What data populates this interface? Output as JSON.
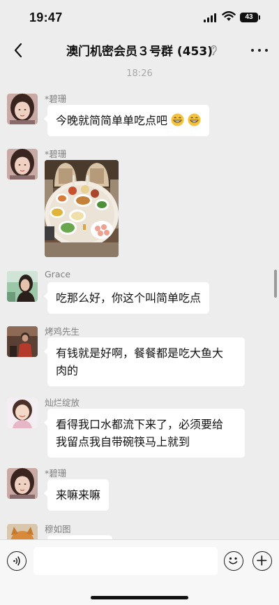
{
  "status_bar": {
    "time": "19:47",
    "battery_level": "43",
    "icons": [
      "signal-icon",
      "wifi-icon",
      "battery-icon"
    ]
  },
  "nav": {
    "title": "澳门机密会员３号群 (453)",
    "back_icon": "chevron-left-icon",
    "mute_icon": "ear-icon",
    "more_icon": "more-dots-icon"
  },
  "chat": {
    "timestamp": "18:26",
    "messages": [
      {
        "sender": "*碧珊",
        "type": "text",
        "text": "今晚就简简单单吃点吧",
        "emoji": "grinning-face-icon ×2"
      },
      {
        "sender": "*碧珊",
        "type": "image",
        "image": "dinner-table-photo"
      },
      {
        "sender": "Grace",
        "type": "text",
        "text": "吃那么好，你这个叫简单吃点"
      },
      {
        "sender": "烤鸡先生",
        "type": "text",
        "text_lines": [
          "有钱就是好啊，餐餐都是吃大鱼大",
          "肉的"
        ]
      },
      {
        "sender": "灿烂绽放",
        "type": "text",
        "text_lines": [
          "看得我口水都流下来了，必须要给",
          "我留点我自带碗筷马上就到"
        ]
      },
      {
        "sender": "*碧珊",
        "type": "text",
        "text": "来嘛来嘛"
      },
      {
        "sender": "穆如图",
        "type": "text",
        "text": ""
      }
    ]
  },
  "input_bar": {
    "voice_icon": "voice-icon",
    "input_value": "",
    "emoji_icon": "smile-icon",
    "plus_icon": "plus-icon"
  },
  "colors": {
    "background": "#ededed",
    "bubble": "#ffffff",
    "sender_name": "#808080",
    "timestamp": "#a8a8a8"
  }
}
